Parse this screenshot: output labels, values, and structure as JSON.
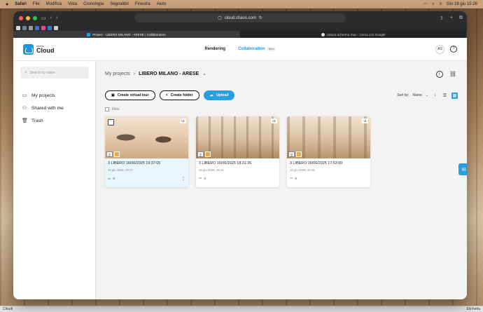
{
  "menubar": {
    "apple": "",
    "app": "Safari",
    "menus": [
      "File",
      "Modifica",
      "Vista",
      "Cronologia",
      "Segnalibri",
      "Finestra",
      "Aiuto"
    ],
    "clock": "Gio 19 giu  15:26"
  },
  "browser": {
    "address": "cloud.chaos.com",
    "tabs": [
      {
        "label": "Project - LIBERO MILANO - ARESE | Collaboration"
      },
      {
        "label": "cattura schermo mac - Cerca con Google"
      }
    ]
  },
  "app": {
    "logo_small": "chaos",
    "logo_big": "Cloud",
    "nav": {
      "rendering": "Rendering",
      "collaboration": "Collaboration",
      "beta": "Beta"
    },
    "avatar": "AS",
    "help": "?"
  },
  "sidebar": {
    "search_placeholder": "Search by name",
    "items": [
      {
        "label": "My projects"
      },
      {
        "label": "Shared with me"
      },
      {
        "label": "Trash"
      }
    ]
  },
  "main": {
    "breadcrumb_root": "My projects",
    "breadcrumb_current": "LIBERO MILANO - ARESE",
    "actions": {
      "virtual_tour": "Create virtual tour",
      "folder": "Create folder",
      "upload": "Upload"
    },
    "sort_label": "Sort by:",
    "sort_value": "Name",
    "files_label": "Files",
    "cards": [
      {
        "title": "3 LIBERO 16/06/2025 19:37:05",
        "date": "18 giu 2025, 19:37",
        "comments": "0",
        "version": "v1"
      },
      {
        "title": "3 LIBERO 16/06/2025 18:31:35",
        "date": "16 giu 2025, 19:19",
        "comments": "0",
        "version": "v1"
      },
      {
        "title": "3 LIBERO 16/06/2025 17:53:00",
        "date": "16 giu 2025, 19:18",
        "comments": "0",
        "version": "v1"
      }
    ]
  },
  "dock_bar": {
    "left": "Chiudi",
    "right": "Etichetta"
  }
}
